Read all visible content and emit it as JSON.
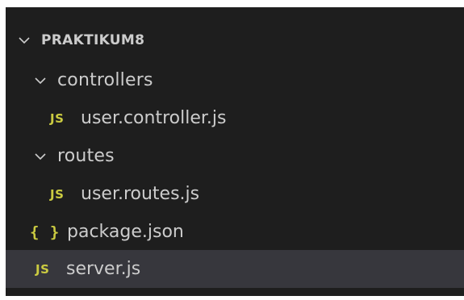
{
  "explorer": {
    "root": {
      "label": "PRAKTIKUM8",
      "icon": "chevron-down-icon"
    },
    "items": [
      {
        "label": "controllers",
        "type": "folder",
        "icon": "chevron-down-icon"
      },
      {
        "label": "user.controller.js",
        "type": "file",
        "icon_text": "JS",
        "icon": "js-file-icon"
      },
      {
        "label": "routes",
        "type": "folder",
        "icon": "chevron-down-icon"
      },
      {
        "label": "user.routes.js",
        "type": "file",
        "icon_text": "JS",
        "icon": "js-file-icon"
      },
      {
        "label": "package.json",
        "type": "file",
        "icon_text": "{ }",
        "icon": "json-file-icon"
      },
      {
        "label": "server.js",
        "type": "file",
        "icon_text": "JS",
        "icon": "js-file-icon",
        "selected": true
      }
    ]
  },
  "colors": {
    "background": "#1e1e1e",
    "selected_row": "#37373d",
    "text": "#cccccc",
    "js_icon": "#cbcb41",
    "json_icon": "#cbcb41"
  }
}
